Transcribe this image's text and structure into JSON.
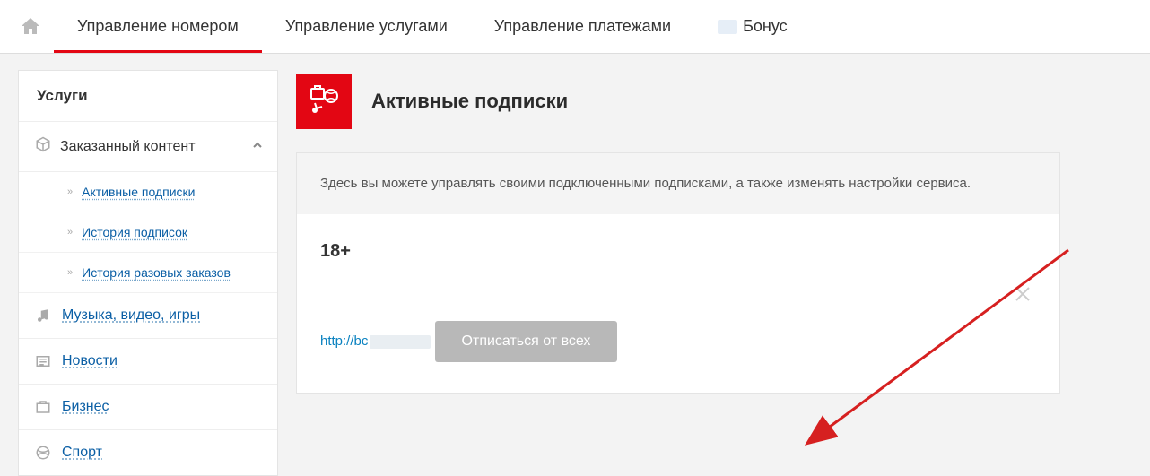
{
  "nav": {
    "tabs": [
      {
        "label": "Управление номером",
        "active": true
      },
      {
        "label": "Управление услугами",
        "active": false
      },
      {
        "label": "Управление платежами",
        "active": false
      },
      {
        "label": "Бонус",
        "active": false
      }
    ]
  },
  "sidebar": {
    "header": "Услуги",
    "ordered_group": {
      "label": "Заказанный контент",
      "items": [
        "Активные подписки",
        "История подписок",
        "История разовых заказов"
      ]
    },
    "categories": [
      {
        "icon": "music-icon",
        "label": "Музыка, видео, игры"
      },
      {
        "icon": "news-icon",
        "label": "Новости"
      },
      {
        "icon": "business-icon",
        "label": "Бизнес"
      },
      {
        "icon": "sport-icon",
        "label": "Спорт"
      }
    ]
  },
  "main": {
    "title": "Активные подписки",
    "intro": "Здесь вы можете управлять своими подключенными подписками, а также изменять настройки сервиса.",
    "subscription": {
      "label": "18+",
      "link_prefix": "http://bc"
    },
    "unsubscribe_all_label": "Отписаться от всех"
  }
}
